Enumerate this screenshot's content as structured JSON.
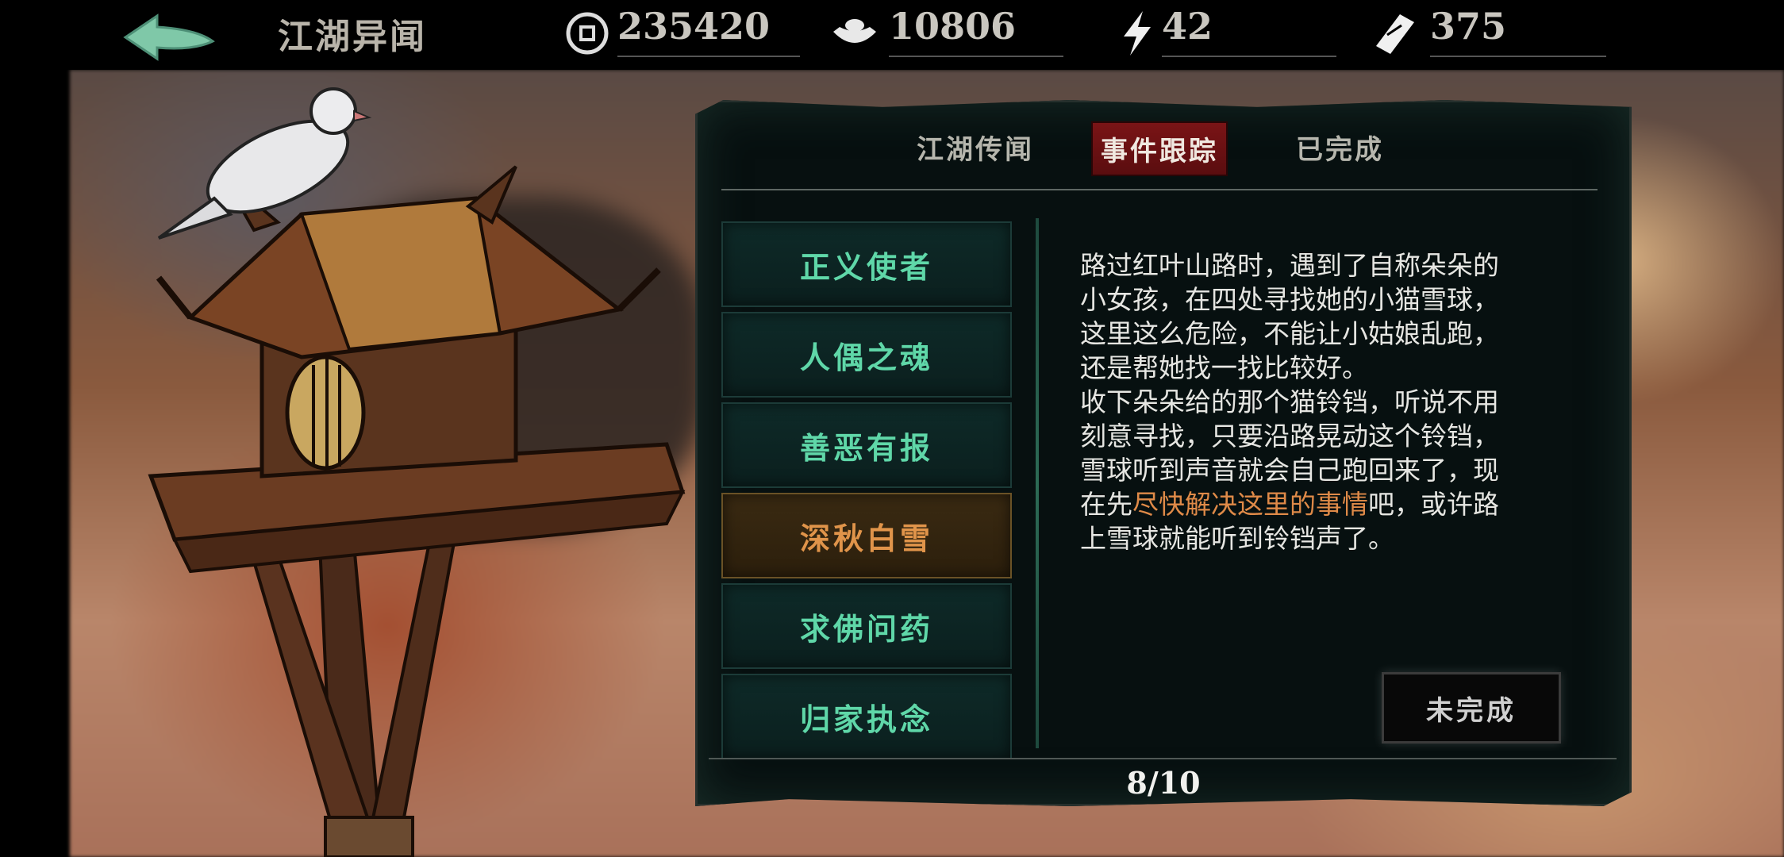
{
  "header": {
    "title": "江湖异闻",
    "resources": [
      {
        "icon": "coin-icon",
        "value": "235420"
      },
      {
        "icon": "silver-ingot-icon",
        "value": "10806"
      },
      {
        "icon": "lightning-icon",
        "value": "42"
      },
      {
        "icon": "ticket-icon",
        "value": "375"
      }
    ],
    "plus": "+"
  },
  "tabs": [
    {
      "label": "江湖传闻",
      "active": false
    },
    {
      "label": "事件跟踪",
      "active": true
    },
    {
      "label": "已完成",
      "active": false
    }
  ],
  "events": [
    {
      "label": "正义使者",
      "selected": false
    },
    {
      "label": "人偶之魂",
      "selected": false
    },
    {
      "label": "善恶有报",
      "selected": false
    },
    {
      "label": "深秋白雪",
      "selected": true
    },
    {
      "label": "求佛问药",
      "selected": false
    },
    {
      "label": "归家执念",
      "selected": false
    }
  ],
  "description": {
    "lines": [
      "路过红叶山路时，遇到了自称朵朵的",
      "小女孩，在四处寻找她的小猫雪球，",
      "这里这么危险，不能让小姑娘乱跑，",
      "还是帮她找一找比较好。",
      "收下朵朵给的那个猫铃铛，听说不用",
      "刻意寻找，只要沿路晃动这个铃铛，",
      "雪球听到声音就会自己跑回来了，现"
    ],
    "line8_prefix": "在先",
    "line8_highlight": "尽快解决这里的事情",
    "line8_suffix": "吧，或许路",
    "line9": "上雪球就能听到铃铛声了。"
  },
  "status_button": "未完成",
  "page_indicator": "8/10",
  "colors": {
    "active_tab": "#7a1416",
    "event_text": "#5fd7a8",
    "selected_event_text": "#e0944a",
    "highlight_text": "#df8a48"
  }
}
